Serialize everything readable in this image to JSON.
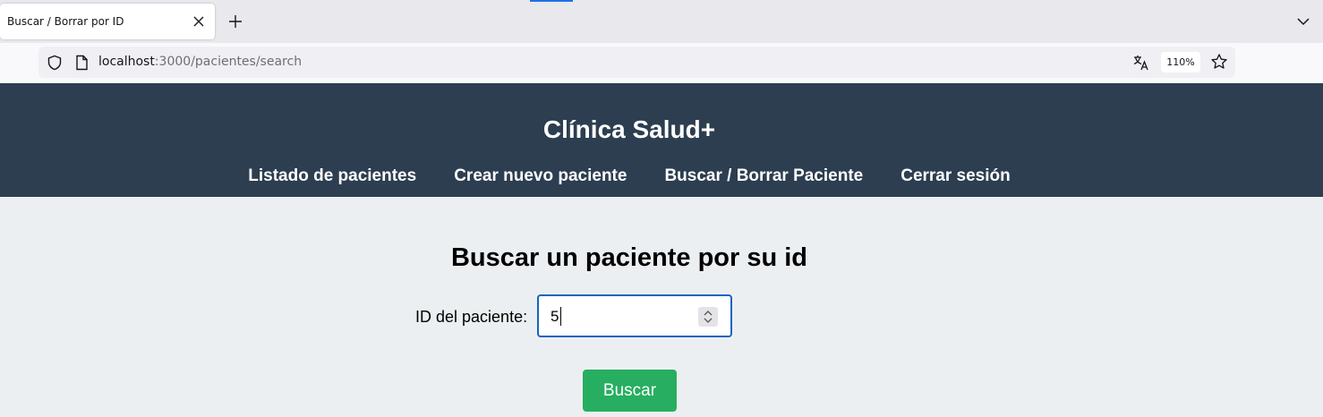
{
  "browser": {
    "tab_title": "Buscar / Borrar por ID",
    "url_host": "localhost",
    "url_path": ":3000/pacientes/search",
    "zoom": "110%"
  },
  "header": {
    "title": "Clínica Salud+",
    "nav": [
      "Listado de pacientes",
      "Crear nuevo paciente",
      "Buscar / Borrar Paciente",
      "Cerrar sesión"
    ]
  },
  "main": {
    "heading": "Buscar un paciente por su id",
    "label": "ID del paciente:",
    "input_value": "5",
    "button_label": "Buscar"
  },
  "colors": {
    "header_bg": "#2c3e50",
    "page_bg": "#eceff1",
    "button_bg": "#27ae60",
    "input_border": "#1565c0"
  }
}
